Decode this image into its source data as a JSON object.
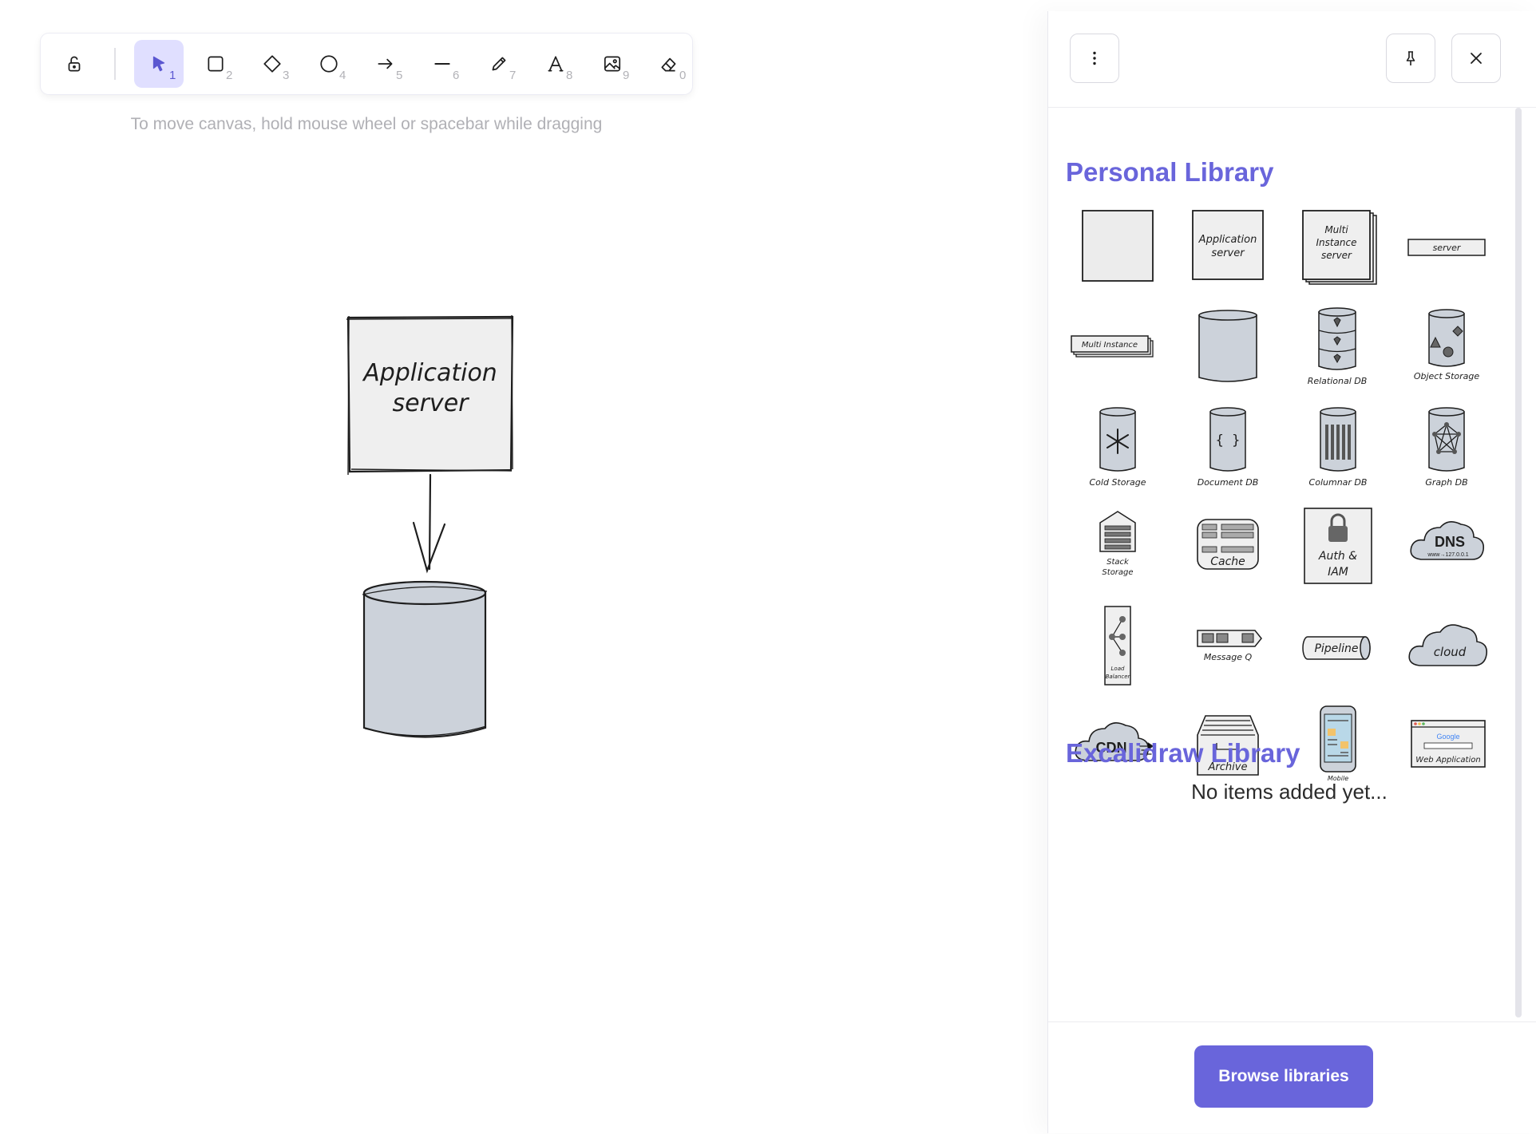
{
  "toolbar": {
    "tools": [
      {
        "name": "selection",
        "key": "1",
        "icon": "pointer-icon",
        "active": true
      },
      {
        "name": "rectangle",
        "key": "2",
        "icon": "square-icon"
      },
      {
        "name": "diamond",
        "key": "3",
        "icon": "diamond-icon"
      },
      {
        "name": "ellipse",
        "key": "4",
        "icon": "circle-icon"
      },
      {
        "name": "arrow",
        "key": "5",
        "icon": "arrow-icon"
      },
      {
        "name": "line",
        "key": "6",
        "icon": "line-icon"
      },
      {
        "name": "draw",
        "key": "7",
        "icon": "pencil-icon"
      },
      {
        "name": "text",
        "key": "8",
        "icon": "text-icon"
      },
      {
        "name": "image",
        "key": "9",
        "icon": "image-icon"
      },
      {
        "name": "eraser",
        "key": "0",
        "icon": "eraser-icon"
      }
    ],
    "lock_icon": "unlock-icon"
  },
  "hint": "To move canvas, hold mouse wheel or spacebar while dragging",
  "canvas": {
    "box_label_line1": "Application",
    "box_label_line2": "server"
  },
  "library": {
    "menu_icon": "more-vertical-icon",
    "pin_icon": "pin-icon",
    "close_icon": "close-icon",
    "personal_title": "Personal Library",
    "excalidraw_title": "Excalidraw Library",
    "empty_message": "No items added yet...",
    "browse_button": "Browse libraries",
    "items": {
      "app_server": [
        "Application",
        "server"
      ],
      "multi_instance_server": [
        "Multi",
        "Instance",
        "server"
      ],
      "server": "server",
      "multi_instance": "Multi Instance",
      "relational_db": "Relational DB",
      "object_storage": "Object Storage",
      "cold_storage": "Cold Storage",
      "document_db": "Document DB",
      "document_db_glyph": "{ }",
      "columnar_db": "Columnar DB",
      "graph_db": "Graph DB",
      "stack_storage": [
        "Stack",
        "Storage"
      ],
      "cache": "Cache",
      "auth": [
        "Auth &",
        "IAM"
      ],
      "dns": "DNS",
      "dns_sub": "www→127.0.0.1",
      "load_balancer": [
        "Load",
        "Balancer"
      ],
      "message_q": "Message Q",
      "pipeline": "Pipeline",
      "cloud": "cloud",
      "cdn": "CDN",
      "archive": "Archive",
      "mobile": "Mobile",
      "web_app_brand": "Google",
      "web_app": "Web Application"
    }
  },
  "colors": {
    "accent": "#6965db",
    "accent_light": "#e0dfff",
    "db_fill": "#ccd2da",
    "box_fill": "#efefef"
  }
}
